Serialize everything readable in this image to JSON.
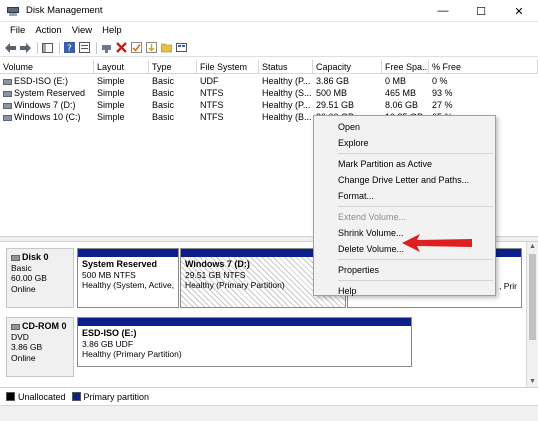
{
  "window": {
    "title": "Disk Management",
    "controls": {
      "minimize": "—",
      "maximize": "☐",
      "close": "✕"
    }
  },
  "menu": [
    "File",
    "Action",
    "View",
    "Help"
  ],
  "toolbar_icons": [
    "back-arrow-icon",
    "forward-arrow-icon",
    "console-tree-icon",
    "help-icon",
    "properties-icon",
    "connect-icon",
    "delete-icon",
    "check-icon",
    "import-icon",
    "open-folder-icon",
    "view-icon"
  ],
  "volume_list": {
    "headers": [
      "Volume",
      "Layout",
      "Type",
      "File System",
      "Status",
      "Capacity",
      "Free Spa...",
      "% Free"
    ],
    "rows": [
      [
        "ESD-ISO (E:)",
        "Simple",
        "Basic",
        "UDF",
        "Healthy (P...",
        "3.86 GB",
        "0 MB",
        "0 %"
      ],
      [
        "System Reserved",
        "Simple",
        "Basic",
        "NTFS",
        "Healthy (S...",
        "500 MB",
        "465 MB",
        "93 %"
      ],
      [
        "Windows 7 (D:)",
        "Simple",
        "Basic",
        "NTFS",
        "Healthy (P...",
        "29.51 GB",
        "8.06 GB",
        "27 %"
      ],
      [
        "Windows 10 (C:)",
        "Simple",
        "Basic",
        "NTFS",
        "Healthy (B...",
        "30.00 GB",
        "10.25 GB",
        "65 %"
      ]
    ]
  },
  "disks": [
    {
      "name": "Disk 0",
      "type": "Basic",
      "size": "60.00 GB",
      "status": "Online",
      "partitions": [
        {
          "name": "System Reserved",
          "detail": "500 MB NTFS",
          "status": "Healthy (System, Active,"
        },
        {
          "name": "Windows 7  (D:)",
          "detail": "29.51 GB NTFS",
          "status": "Healthy (Primary Partition)"
        },
        {
          "name": "",
          "detail": "",
          "status": ", Prir"
        }
      ]
    },
    {
      "name": "CD-ROM 0",
      "type": "DVD",
      "size": "3.86 GB",
      "status": "Online",
      "partitions": [
        {
          "name": "ESD-ISO  (E:)",
          "detail": "3.86 GB UDF",
          "status": "Healthy (Primary Partition)"
        }
      ]
    }
  ],
  "legend": [
    {
      "label": "Unallocated",
      "color": "#000000"
    },
    {
      "label": "Primary partition",
      "color": "#0c1f8a"
    }
  ],
  "context_menu": {
    "groups": [
      [
        {
          "label": "Open",
          "enabled": true
        },
        {
          "label": "Explore",
          "enabled": true
        }
      ],
      [
        {
          "label": "Mark Partition as Active",
          "enabled": true
        },
        {
          "label": "Change Drive Letter and Paths...",
          "enabled": true
        },
        {
          "label": "Format...",
          "enabled": true
        }
      ],
      [
        {
          "label": "Extend Volume...",
          "enabled": false
        },
        {
          "label": "Shrink Volume...",
          "enabled": true
        },
        {
          "label": "Delete Volume...",
          "enabled": true
        }
      ],
      [
        {
          "label": "Properties",
          "enabled": true
        }
      ],
      [
        {
          "label": "Help",
          "enabled": true
        }
      ]
    ]
  },
  "colors": {
    "primary_partition": "#0c1f8a",
    "annotation_arrow": "#e02020"
  }
}
